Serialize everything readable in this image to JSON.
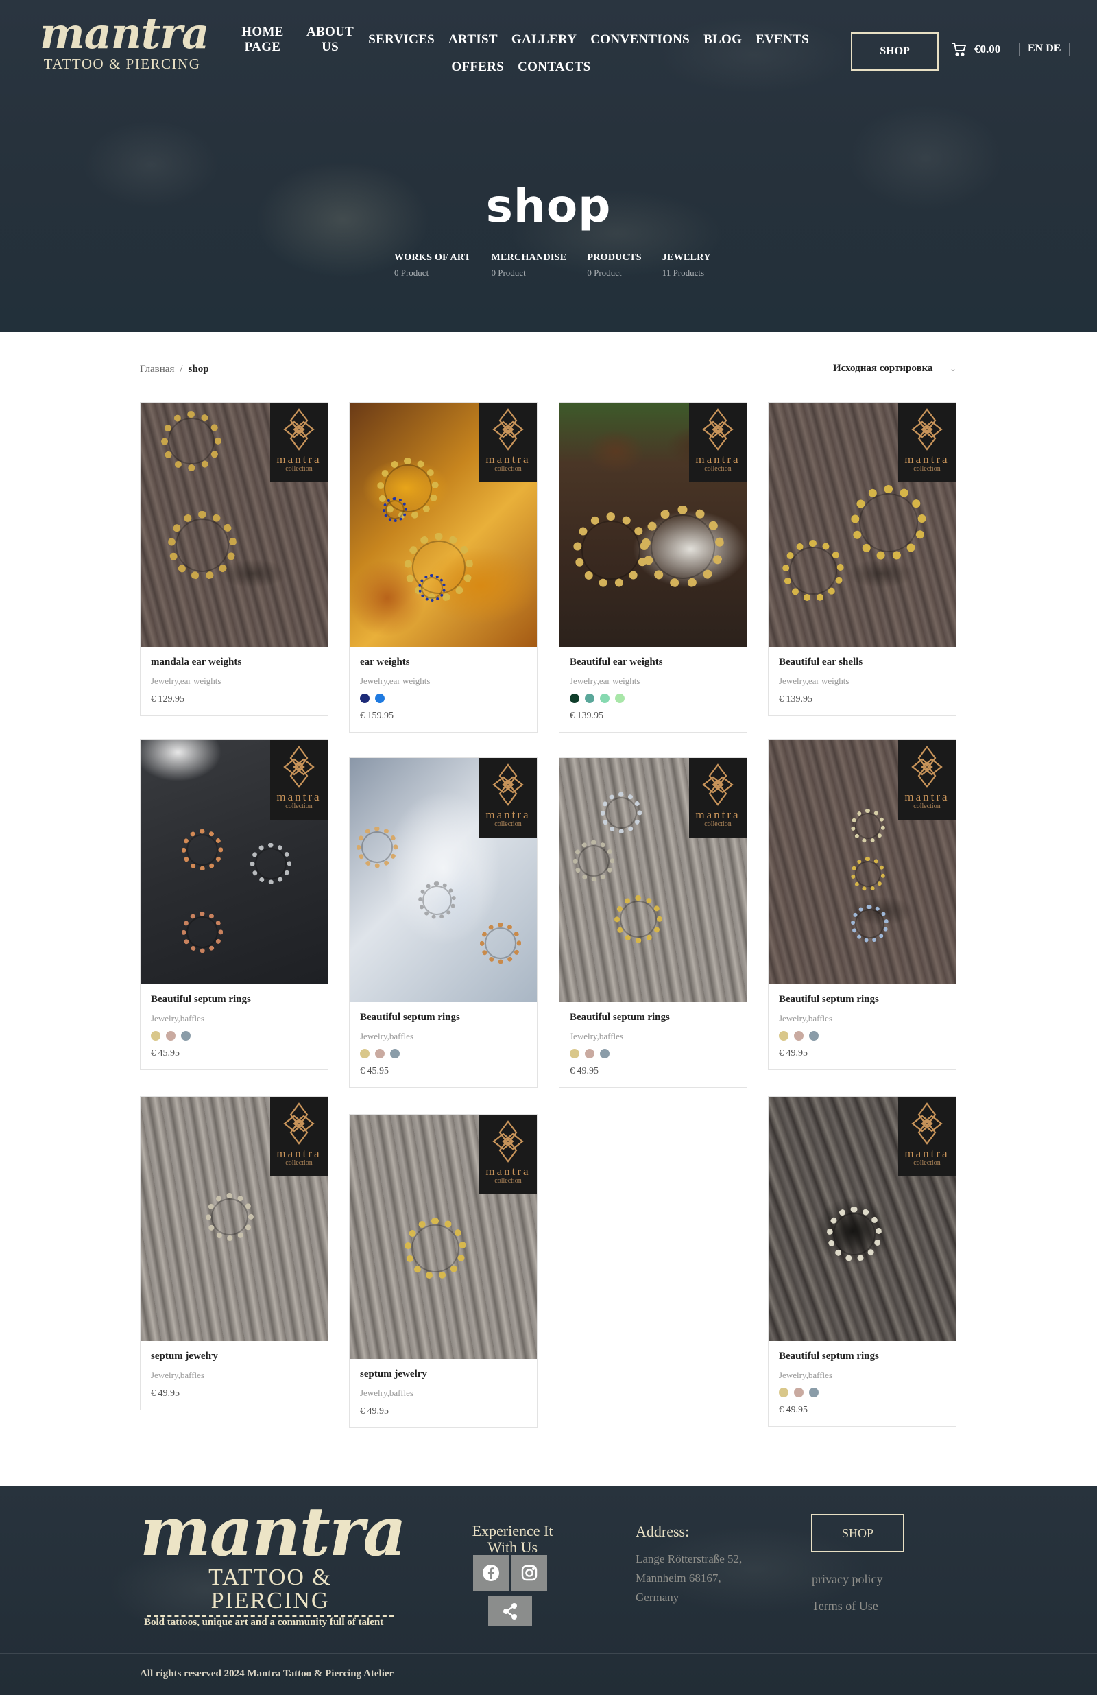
{
  "header": {
    "logo_word": "mantra",
    "logo_sub": "TATTOO & PIERCING",
    "nav_row1": [
      "HOME PAGE",
      "ABOUT US",
      "SERVICES",
      "ARTIST",
      "GALLERY",
      "CONVENTIONS",
      "BLOG",
      "EVENTS"
    ],
    "nav_row2": [
      "OFFERS",
      "CONTACTS"
    ],
    "shop_button": "SHOP",
    "cart_total": "€0.00",
    "lang": "EN DE"
  },
  "hero": {
    "title": "shop",
    "categories": [
      {
        "name": "WORKS OF ART",
        "count": "0 Product"
      },
      {
        "name": "MERCHANDISE",
        "count": "0 Product"
      },
      {
        "name": "PRODUCTS",
        "count": "0 Product"
      },
      {
        "name": "JEWELRY",
        "count": "11 Products"
      }
    ]
  },
  "toolbar": {
    "breadcrumb_home": "Главная",
    "breadcrumb_sep": "/",
    "breadcrumb_current": "shop",
    "sort_label": "Исходная сортировка"
  },
  "badge": {
    "word": "mantra",
    "sub": "collection"
  },
  "products": [
    {
      "name": "mandala ear weights",
      "cats": "Jewelry,ear weights",
      "price": "€ 129.95",
      "swatches": []
    },
    {
      "name": "ear weights",
      "cats": "Jewelry,ear weights",
      "price": "€ 159.95",
      "swatches": [
        "#1d2b78",
        "#1f7ae0"
      ]
    },
    {
      "name": "Beautiful ear weights",
      "cats": "Jewelry,ear weights",
      "price": "€ 139.95",
      "swatches": [
        "#0f3d2a",
        "#5aa79a",
        "#86d9b0",
        "#a8e6a8"
      ]
    },
    {
      "name": "Beautiful ear shells",
      "cats": "Jewelry,ear weights",
      "price": "€ 139.95",
      "swatches": []
    },
    {
      "name": "Beautiful septum rings",
      "cats": "Jewelry,baffles",
      "price": "€ 45.95",
      "swatches": [
        "#d9c78a",
        "#c9aaa0",
        "#8a9ca8"
      ]
    },
    {
      "name": "Beautiful septum rings",
      "cats": "Jewelry,baffles",
      "price": "€ 45.95",
      "swatches": [
        "#d9c78a",
        "#c9aaa0",
        "#8a9ca8"
      ]
    },
    {
      "name": "Beautiful septum rings",
      "cats": "Jewelry,baffles",
      "price": "€ 49.95",
      "swatches": [
        "#d9c78a",
        "#c9aaa0",
        "#8a9ca8"
      ]
    },
    {
      "name": "Beautiful septum rings",
      "cats": "Jewelry,baffles",
      "price": "€ 49.95",
      "swatches": [
        "#d9c78a",
        "#c9aaa0",
        "#8a9ca8"
      ]
    },
    {
      "name": "septum jewelry",
      "cats": "Jewelry,baffles",
      "price": "€ 49.95",
      "swatches": []
    },
    {
      "name": "septum jewelry",
      "cats": "Jewelry,baffles",
      "price": "€ 49.95",
      "swatches": []
    },
    {
      "name": "Beautiful septum rings",
      "cats": "Jewelry,baffles",
      "price": "€ 49.95",
      "swatches": [
        "#d9c78a",
        "#c9aaa0",
        "#8a9ca8"
      ]
    }
  ],
  "footer": {
    "logo_word": "mantra",
    "logo_sub": "TATTOO & PIERCING",
    "tagline": "Bold tattoos, unique art and a community full of talent",
    "experience": "Experience It With Us",
    "address_heading": "Address:",
    "address_lines": [
      "Lange Rötterstraße 52,",
      "Mannheim 68167,",
      "Germany"
    ],
    "shop_button": "SHOP",
    "privacy": "privacy policy",
    "terms": "Terms of Use",
    "copyright": "All rights reserved 2024 Mantra Tattoo & Piercing Atelier"
  },
  "colors": {
    "hero_bg": "#26313b",
    "accent_cream": "#e8e0c4",
    "badge_bg": "#1a1a1a",
    "badge_gold": "#c8945a"
  }
}
